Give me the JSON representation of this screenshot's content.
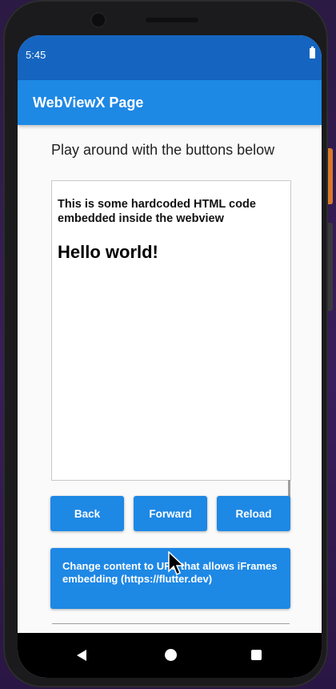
{
  "status_bar": {
    "time": "5:45",
    "battery_icon": "battery-full-icon"
  },
  "app_bar": {
    "title": "WebViewX Page",
    "color": "#1e88e5"
  },
  "page": {
    "subtitle": "Play around with the buttons below"
  },
  "webview": {
    "paragraph": "This is some hardcoded HTML code embedded inside the webview",
    "heading": "Hello world!"
  },
  "buttons": {
    "back": "Back",
    "forward": "Forward",
    "reload": "Reload",
    "change_content": "Change content to URL that allows iFrames embedding (https://flutter.dev)"
  },
  "nav_bar": {
    "back_icon": "triangle-back-icon",
    "home_icon": "circle-home-icon",
    "recents_icon": "square-recents-icon"
  },
  "colors": {
    "status_bar": "#1565c0",
    "accent": "#1e88e5",
    "background": "#fafafa"
  }
}
